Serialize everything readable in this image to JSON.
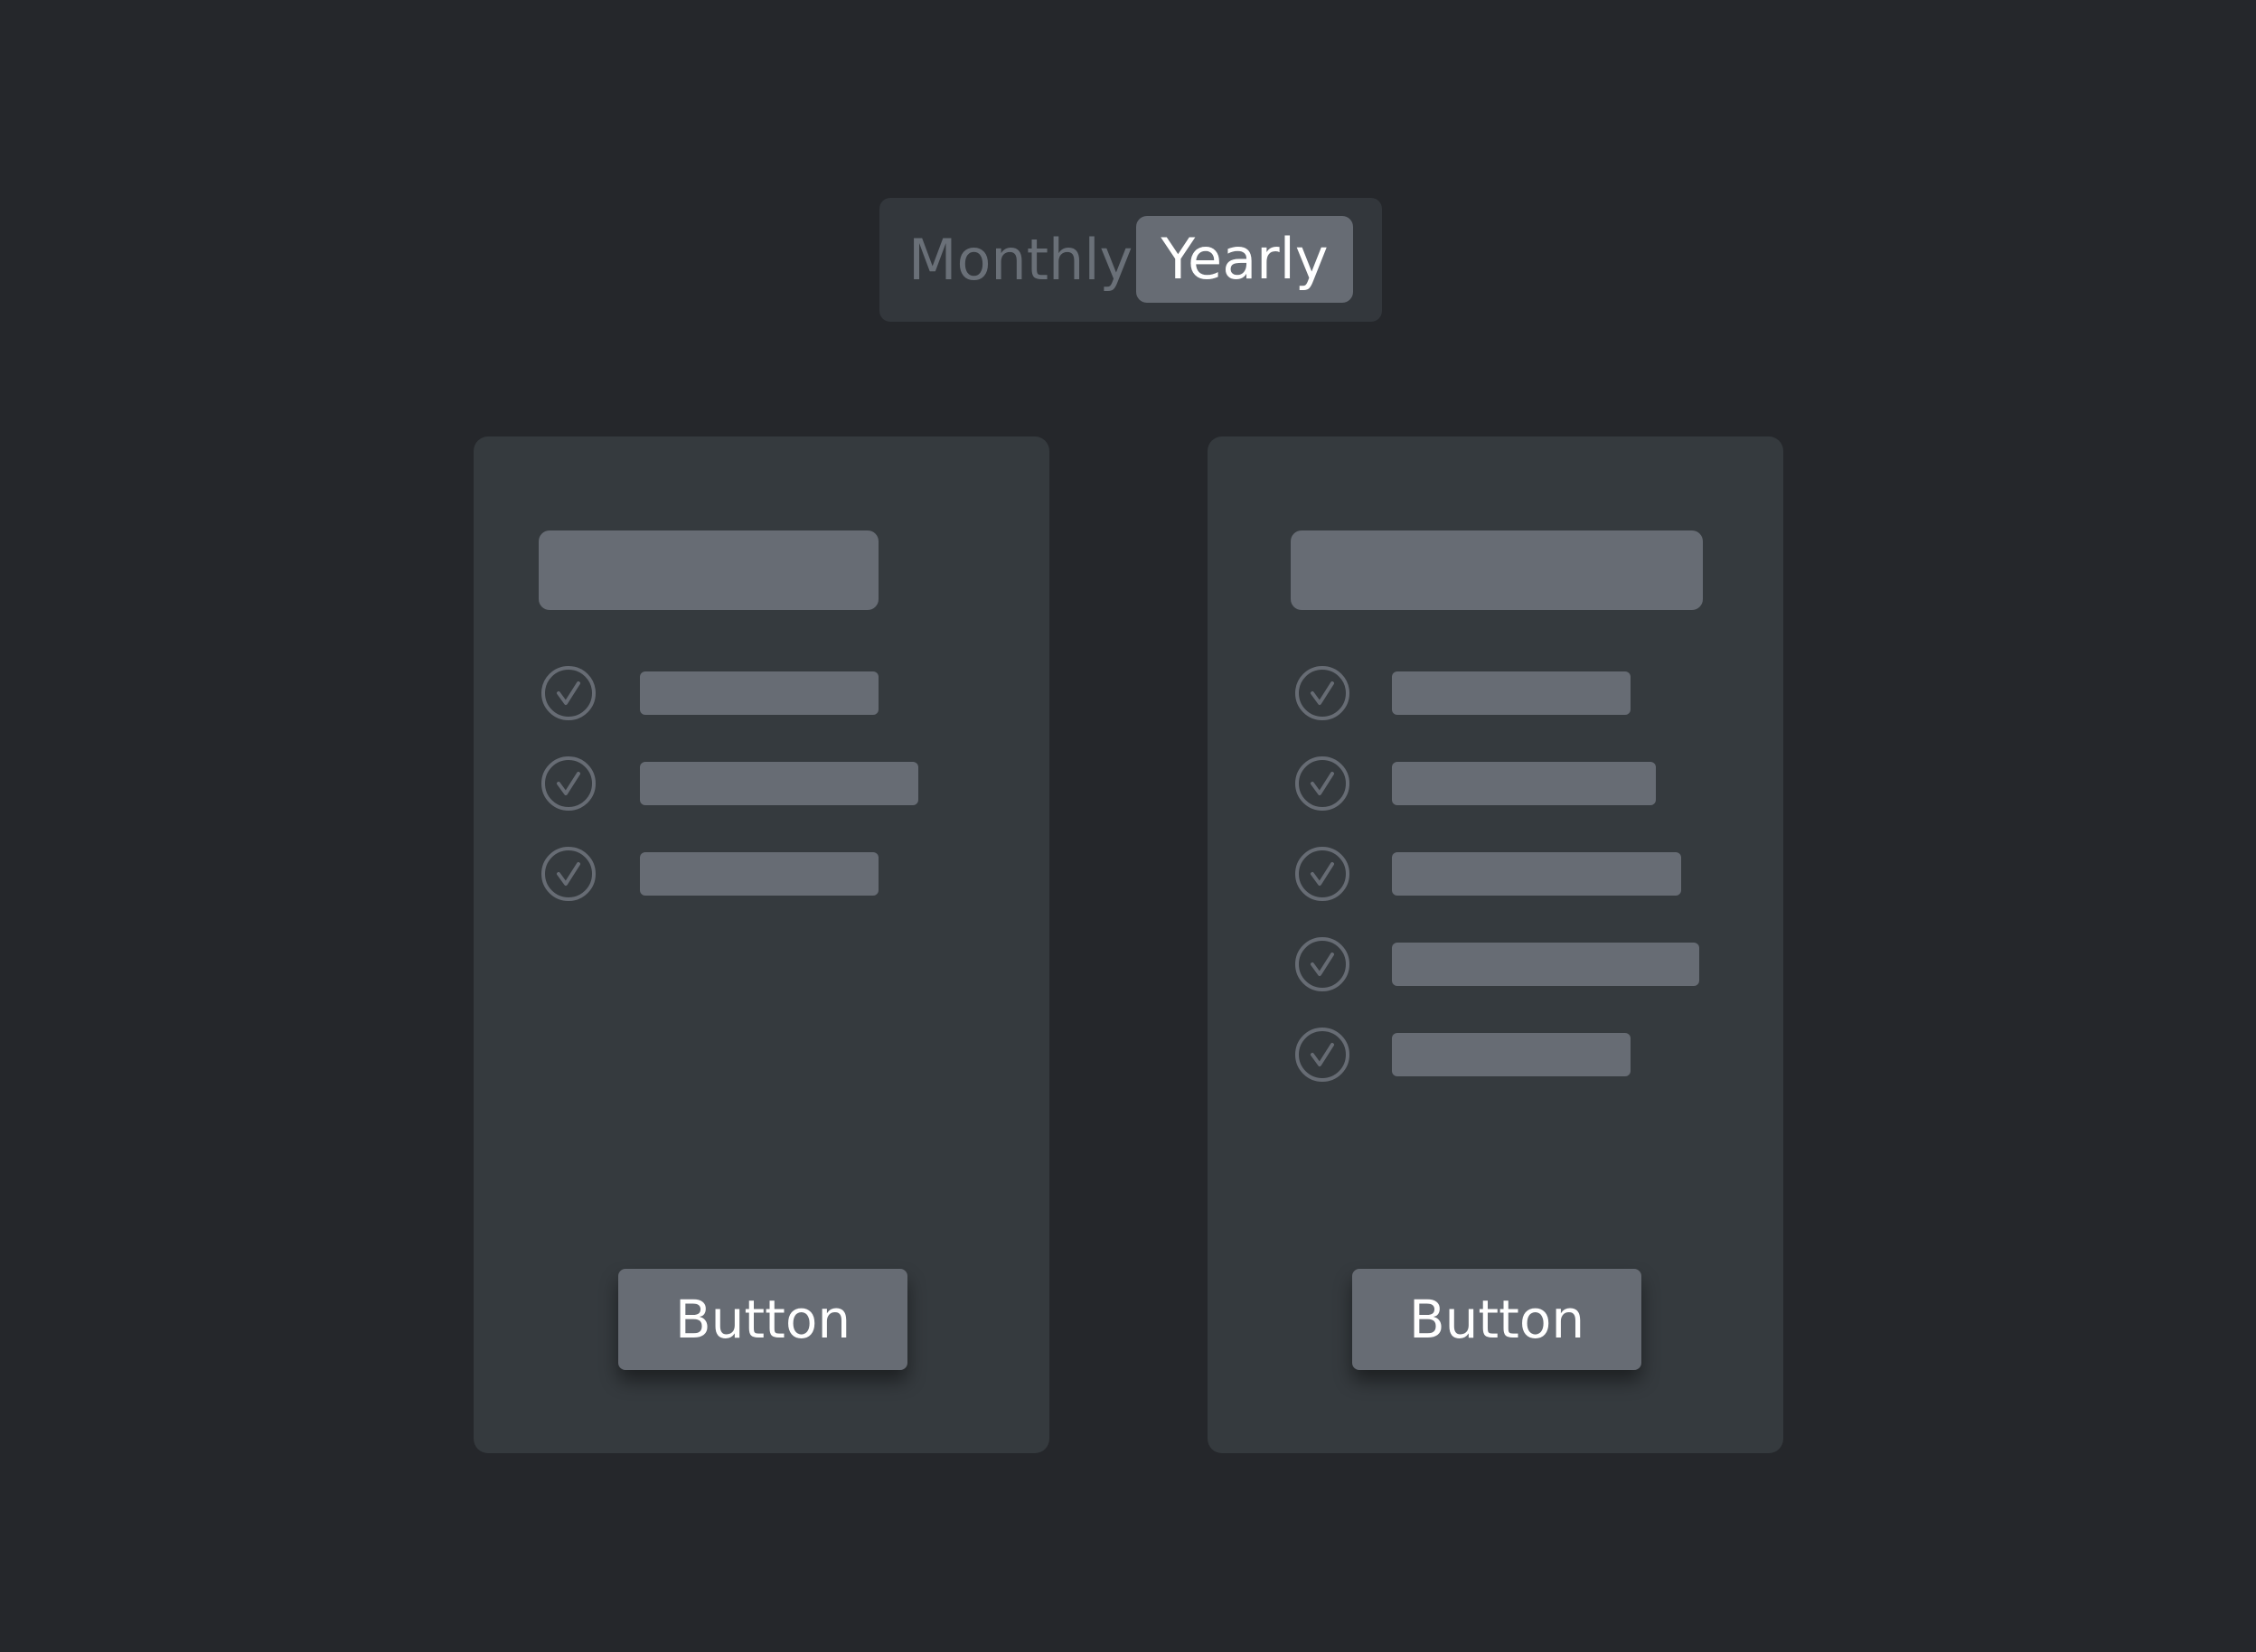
{
  "billing_toggle": {
    "options": [
      {
        "label": "Monthly",
        "selected": false
      },
      {
        "label": "Yearly",
        "selected": true
      }
    ]
  },
  "plans": [
    {
      "features": [
        {
          "icon": "check-circle-icon"
        },
        {
          "icon": "check-circle-icon"
        },
        {
          "icon": "check-circle-icon"
        }
      ],
      "button_label": "Button"
    },
    {
      "features": [
        {
          "icon": "check-circle-icon"
        },
        {
          "icon": "check-circle-icon"
        },
        {
          "icon": "check-circle-icon"
        },
        {
          "icon": "check-circle-icon"
        },
        {
          "icon": "check-circle-icon"
        }
      ],
      "button_label": "Button"
    }
  ],
  "colors": {
    "background": "#25272b",
    "toggle_track": "#33373c",
    "card": "#353a3e",
    "placeholder": "#676c74",
    "muted_text": "#6a7078",
    "text": "#ffffff"
  }
}
